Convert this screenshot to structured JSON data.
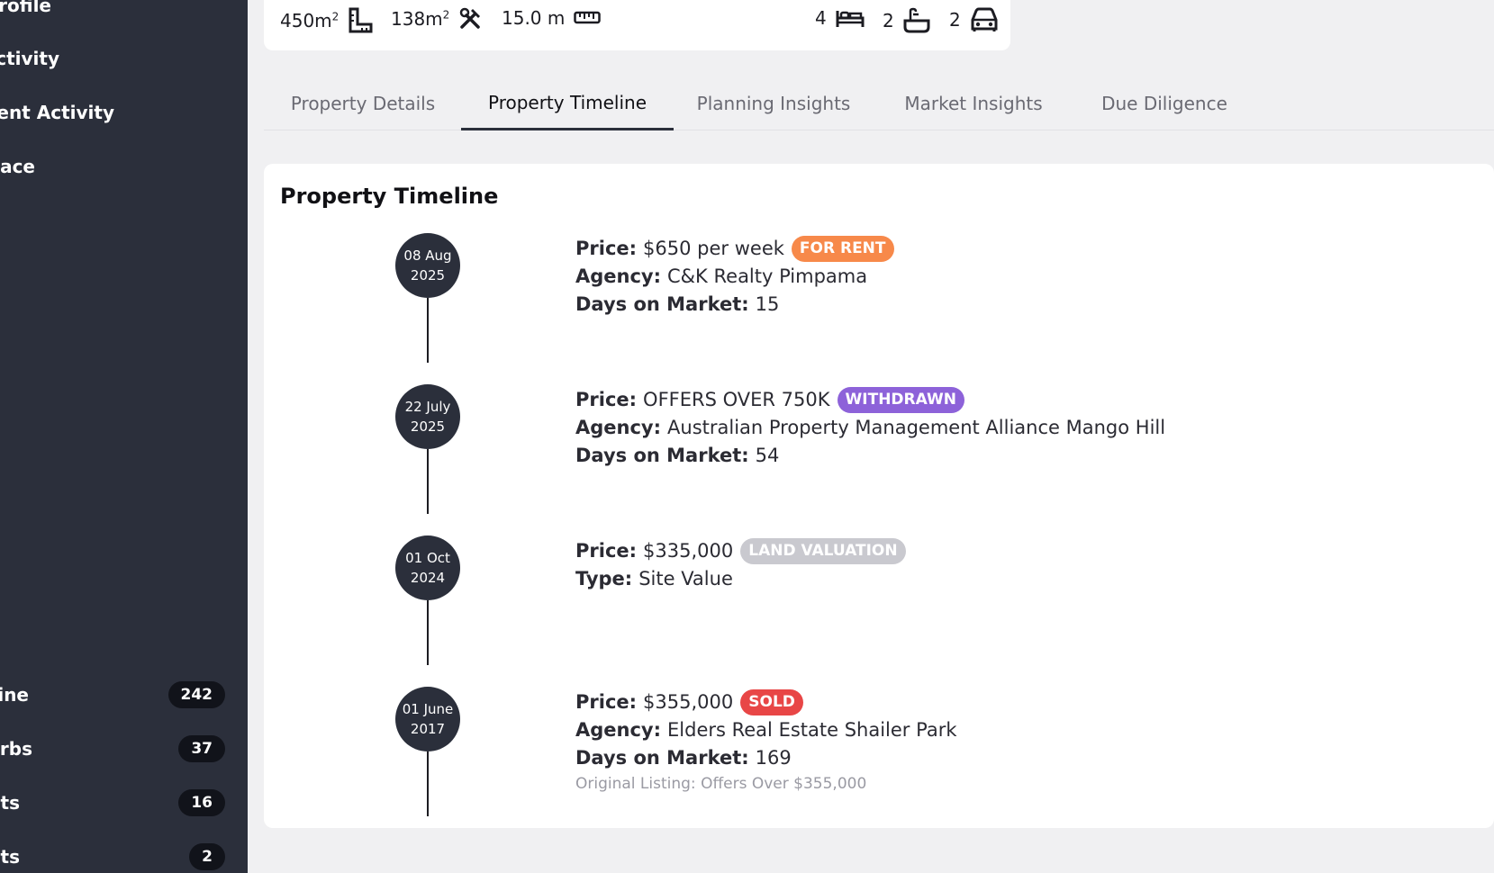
{
  "sidebar": {
    "items": [
      {
        "label": "Profile"
      },
      {
        "label": "Activity"
      },
      {
        "label": "ment Activity"
      },
      {
        "label": "lace"
      }
    ],
    "counted_items": [
      {
        "label": "line",
        "count": "242"
      },
      {
        "label": "urbs",
        "count": "37"
      },
      {
        "label": "nts",
        "count": "16"
      },
      {
        "label": "nts",
        "count": "2"
      }
    ]
  },
  "summary": {
    "land_area": "450m",
    "land_area_sup": "2",
    "floor_area": "138m",
    "floor_area_sup": "2",
    "frontage": "15.0 m",
    "bedrooms": "4",
    "bathrooms": "2",
    "parking": "2"
  },
  "tabs": [
    {
      "label": "Property Details",
      "active": false
    },
    {
      "label": "Property Timeline",
      "active": true
    },
    {
      "label": "Planning Insights",
      "active": false
    },
    {
      "label": "Market Insights",
      "active": false
    },
    {
      "label": "Due Diligence",
      "active": false
    }
  ],
  "timeline": {
    "title": "Property Timeline",
    "entries": [
      {
        "date_day": "08 Aug",
        "date_year": "2025",
        "price_label": "Price:",
        "price": "$650 per week",
        "badge": "FOR RENT",
        "badge_color": "#f7894a",
        "line2_label": "Agency:",
        "line2": "C&K Realty Pimpama",
        "line3_label": "Days on Market:",
        "line3": "15",
        "note": ""
      },
      {
        "date_day": "22 July",
        "date_year": "2025",
        "price_label": "Price:",
        "price": "OFFERS OVER 750K",
        "badge": "WITHDRAWN",
        "badge_color": "#8d62d9",
        "line2_label": "Agency:",
        "line2": "Australian Property Management Alliance Mango Hill",
        "line3_label": "Days on Market:",
        "line3": "54",
        "note": ""
      },
      {
        "date_day": "01 Oct",
        "date_year": "2024",
        "price_label": "Price:",
        "price": "$335,000",
        "badge": "LAND VALUATION",
        "badge_color": "#c9c9cf",
        "line2_label": "Type:",
        "line2": "Site Value",
        "line3_label": "",
        "line3": "",
        "note": ""
      },
      {
        "date_day": "01 June",
        "date_year": "2017",
        "price_label": "Price:",
        "price": "$355,000",
        "badge": "SOLD",
        "badge_color": "#e84646",
        "line2_label": "Agency:",
        "line2": "Elders Real Estate Shailer Park",
        "line3_label": "Days on Market:",
        "line3": "169",
        "note": "Original Listing: Offers Over $355,000"
      }
    ]
  }
}
